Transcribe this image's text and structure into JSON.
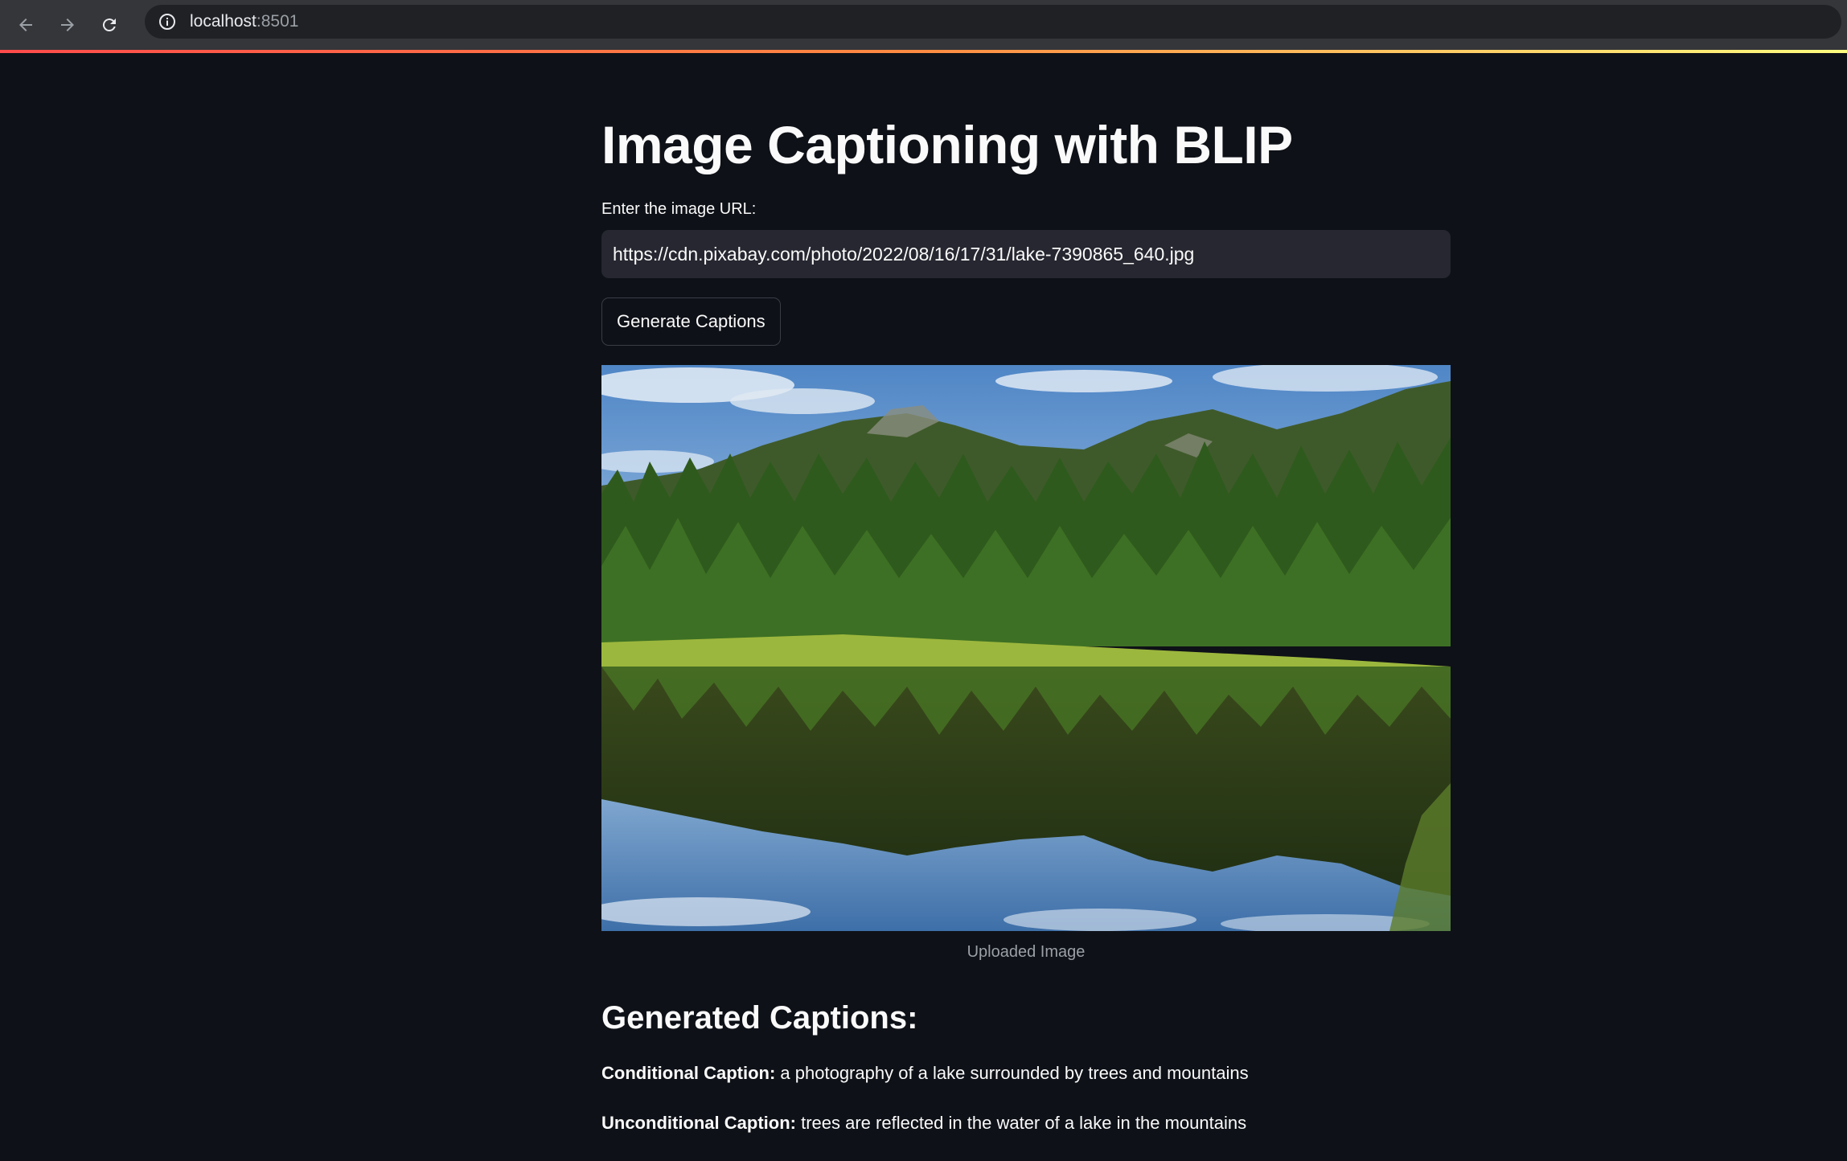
{
  "browser": {
    "url_host": "localhost",
    "url_port": ":8501"
  },
  "app": {
    "title": "Image Captioning with BLIP",
    "url_label": "Enter the image URL:",
    "url_value": "https://cdn.pixabay.com/photo/2022/08/16/17/31/lake-7390865_640.jpg",
    "generate_button": "Generate Captions",
    "image_caption": "Uploaded Image",
    "captions_heading": "Generated Captions:",
    "conditional_label": "Conditional Caption:",
    "conditional_text": "a photography of a lake surrounded by trees and mountains",
    "unconditional_label": "Unconditional Caption:",
    "unconditional_text": "trees are reflected in the water of a lake in the mountains"
  },
  "colors": {
    "background": "#0e1117",
    "input_bg": "#262730",
    "accent_start": "#ff4b4b",
    "accent_end": "#fffd80"
  }
}
